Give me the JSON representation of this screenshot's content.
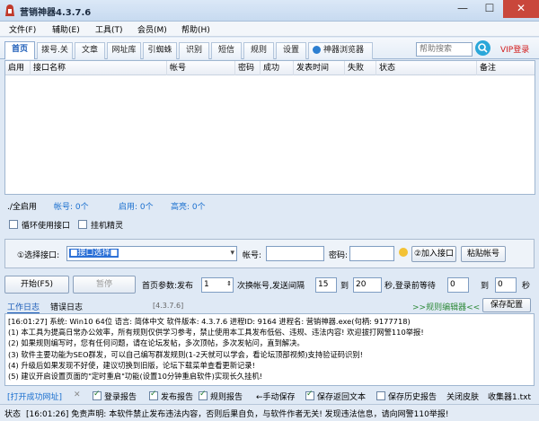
{
  "window": {
    "title": "营销神器4.3.7.6",
    "min": "—",
    "max": "☐",
    "close": "✕"
  },
  "menu": [
    "文件(F)",
    "辅助(E)",
    "工具(T)",
    "会员(M)",
    "帮助(H)"
  ],
  "tabs": [
    "首页",
    "拨号.关",
    "文章",
    "网址库",
    "引蜘蛛",
    "识别",
    "短信",
    "规则",
    "设置",
    "神器浏览器"
  ],
  "search": {
    "placeholder": "帮助搜索"
  },
  "vip_login": "VIP登录",
  "grid": {
    "columns": [
      "启用",
      "接口名称",
      "帐号",
      "密码",
      "成功",
      "发表时间",
      "失败",
      "状态",
      "备注"
    ]
  },
  "status": {
    "all_enable": "./全启用",
    "accounts_label": "帐号: 0个",
    "enabled_label": "启用: 0个",
    "highlight_label": "高亮: 0个"
  },
  "checks": {
    "loop": "循环使用接口",
    "hook": "挂机精灵"
  },
  "interface": {
    "select_label": "①选择接口:",
    "select_value": "■接口选择■",
    "account_label": "帐号:",
    "password_label": "密码:",
    "add_button": "②加入接口",
    "paste_button": "粘贴帐号"
  },
  "run": {
    "start": "开始(F5)",
    "pause": "暂停",
    "params_label": "首页参数:发布",
    "publish_count": "1",
    "switch_label": "次换帐号,发送间隔",
    "interval_from": "15",
    "to1": "到",
    "interval_to": "20",
    "wait_label": "秒,登录前等待",
    "wait_from": "0",
    "to2": "到",
    "wait_to": "0",
    "sec": "秒"
  },
  "log_tabs": {
    "work": "工作日志",
    "error": "错误日志",
    "version": "[4.3.7.6]",
    "rule_editor": ">>规则编辑器<<",
    "save": "保存配置"
  },
  "log_lines": [
    "[16:01:27] 系统: Win10 64位 语言: 简体中文 软件版本: 4.3.7.6 进程ID: 9164 进程名: 营销神器.exe(句柄: 9177718)",
    "(1) 本工具为提高日常办公效率，所有规则仅供学习参考，禁止使用本工具发布低俗、违规、违法内容! 欢迎拔打网警110举报!",
    "(2) 如果规则编写时，您有任何问题，请在论坛发帖，多次顶帖，多次发帖问，直到解决。",
    "(3) 软件主要功能为SEO群发，可以自己编写群发规则(1-2天就可以学会，看论坛顶部视频)支持验证码识别!",
    "(4) 升级后如果发现不好使，建议切换到旧版，论坛下载菜单查看更新记录!",
    "(5) 建议开启设置页面的\"定时重启\"功能(设置10分钟重启软件)实现长久挂机!"
  ],
  "options": {
    "open_success": "[打开成功网址]",
    "login_report": "登录报告",
    "publish_report": "发布报告",
    "rule_report": "规则报告",
    "manual_save": "←手动保存",
    "save_return": "保存返回文本",
    "save_history": "保存历史报告",
    "close_skin": "关闭皮肤",
    "collector": "收集器1.txt"
  },
  "statusbar": {
    "label": "状态",
    "text": "[16:01:26] 免责声明: 本软件禁止发布违法内容，否则后果自负，与软件作者无关! 发现违法信息，请向网警110举报!"
  },
  "colors": {
    "accent": "#1a5bb8",
    "close": "#c9473b",
    "vip": "#d21a1a",
    "green": "#2f8a3a"
  }
}
